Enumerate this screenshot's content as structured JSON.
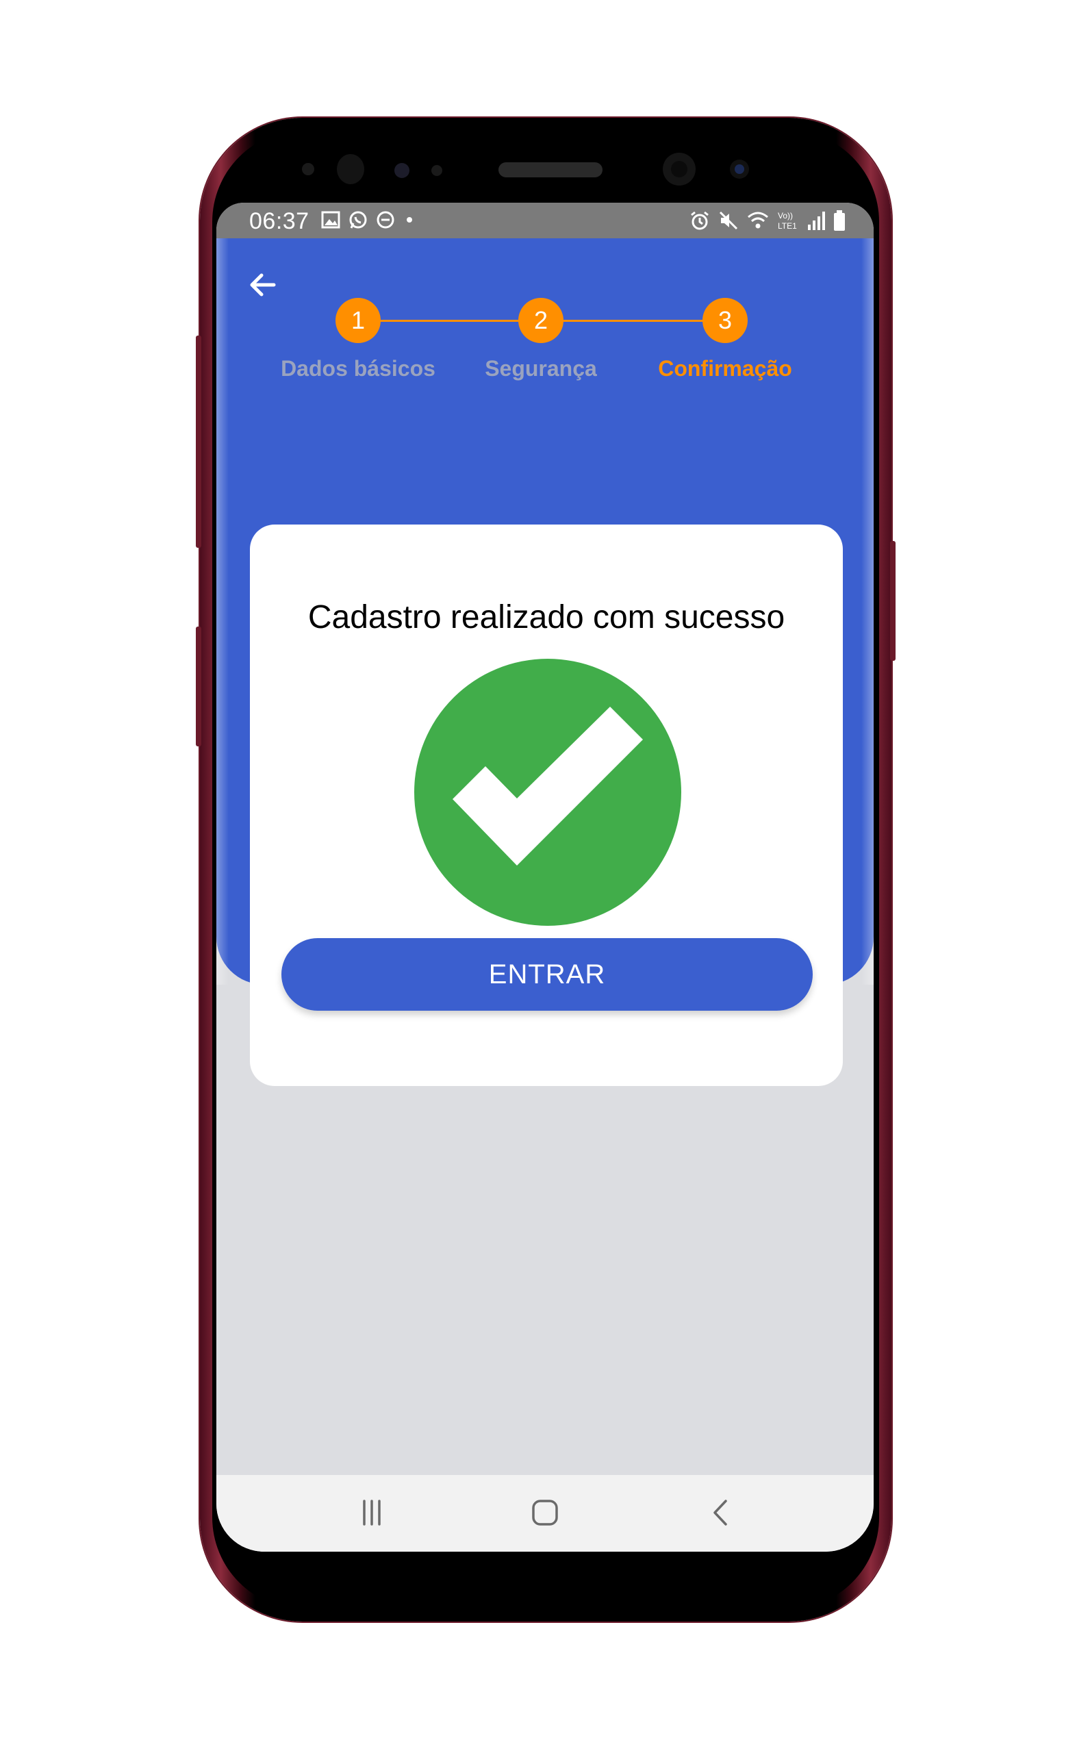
{
  "status_bar": {
    "time": "06:37",
    "left_icons": [
      "gallery-icon",
      "whatsapp-icon",
      "dnd-icon",
      "dot-icon"
    ],
    "right_icons": [
      "alarm-icon",
      "mute-icon",
      "wifi-icon",
      "volte-icon",
      "signal-icon",
      "battery-icon"
    ],
    "volte_text": "Vo)) LTE1"
  },
  "header": {
    "back_icon": "arrow-left-icon",
    "steps": [
      {
        "number": "1",
        "label": "Dados básicos",
        "active": false
      },
      {
        "number": "2",
        "label": "Segurança",
        "active": false
      },
      {
        "number": "3",
        "label": "Confirmação",
        "active": true
      }
    ]
  },
  "card": {
    "title": "Cadastro realizado com sucesso",
    "icon": "success-check-icon",
    "button_label": "ENTRAR"
  },
  "nav_bar": {
    "items": [
      "recent-apps-icon",
      "home-icon",
      "back-icon"
    ]
  },
  "colors": {
    "primary": "#3b5fcf",
    "accent": "#ff8f00",
    "success": "#41ad4a",
    "inactive_label": "#9aa3bf",
    "background": "#dcdde1"
  }
}
